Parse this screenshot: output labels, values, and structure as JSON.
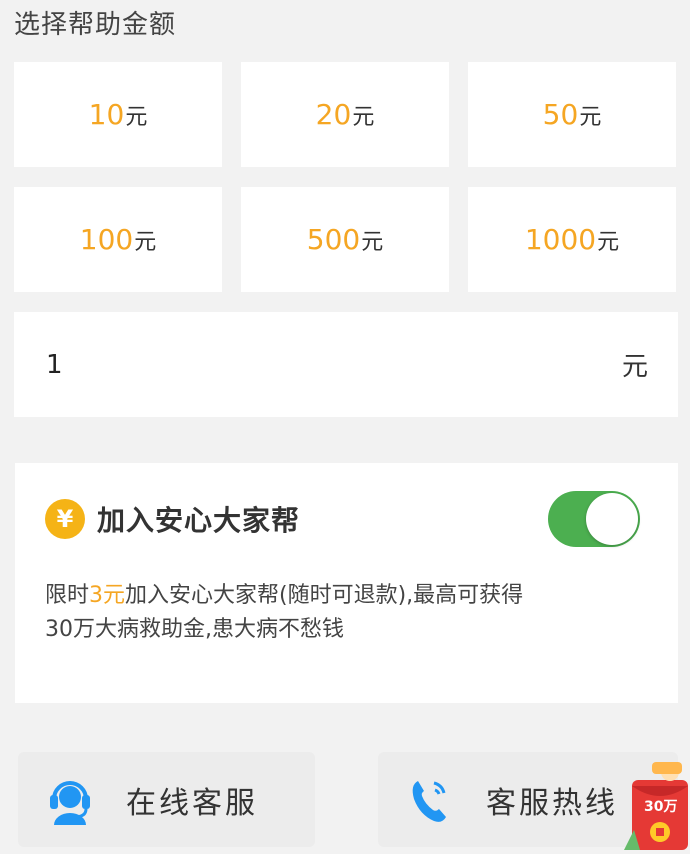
{
  "section_title": "选择帮助金额",
  "amounts": [
    {
      "value": "10",
      "unit": "元"
    },
    {
      "value": "20",
      "unit": "元"
    },
    {
      "value": "50",
      "unit": "元"
    },
    {
      "value": "100",
      "unit": "元"
    },
    {
      "value": "500",
      "unit": "元"
    },
    {
      "value": "1000",
      "unit": "元"
    }
  ],
  "custom_amount": {
    "value": "1",
    "unit": "元"
  },
  "join": {
    "title": "加入安心大家帮",
    "icon": "yen-icon",
    "toggle_on": true,
    "desc_prefix": "限时",
    "desc_highlight": "3元",
    "desc_suffix": "加入安心大家帮(随时可退款),最高可获得30万大病救助金,患大病不愁钱"
  },
  "buttons": {
    "online_service": "在线客服",
    "hotline": "客服热线"
  },
  "redpack": {
    "label": "30万"
  },
  "colors": {
    "accent": "#f5a623",
    "toggle": "#4caf50",
    "icon_blue": "#2196f3",
    "redpack": "#e53935"
  }
}
